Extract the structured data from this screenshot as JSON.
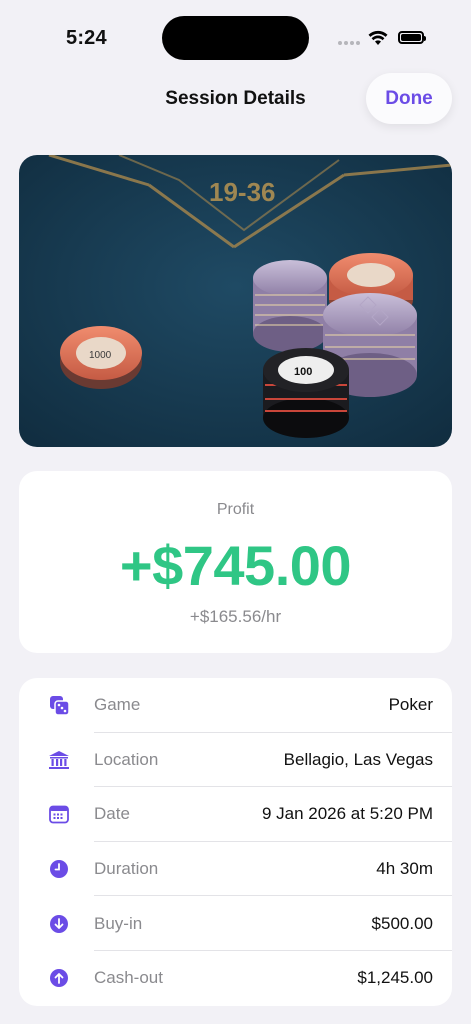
{
  "status": {
    "time": "5:24"
  },
  "nav": {
    "title": "Session Details",
    "done_label": "Done"
  },
  "photo": {
    "description_icon": "casino-chips-photo"
  },
  "profit": {
    "label": "Profit",
    "value": "+$745.00",
    "rate": "+$165.56/hr",
    "color": "#2fc685"
  },
  "details": [
    {
      "icon": "dice-icon",
      "label": "Game",
      "value": "Poker"
    },
    {
      "icon": "bank-icon",
      "label": "Location",
      "value": "Bellagio, Las Vegas"
    },
    {
      "icon": "calendar-icon",
      "label": "Date",
      "value": "9 Jan 2026 at 5:20 PM"
    },
    {
      "icon": "clock-icon",
      "label": "Duration",
      "value": "4h 30m"
    },
    {
      "icon": "arrow-down-circle-icon",
      "label": "Buy-in",
      "value": "$500.00"
    },
    {
      "icon": "arrow-up-circle-icon",
      "label": "Cash-out",
      "value": "$1,245.00"
    }
  ],
  "accent_color": "#6b4ce6"
}
